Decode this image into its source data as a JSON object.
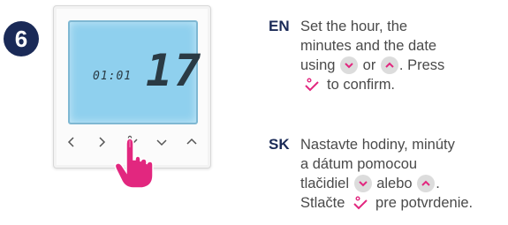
{
  "step": {
    "number": "6"
  },
  "device": {
    "time": "01:01",
    "day": "17",
    "buttons": [
      "left-arrow-icon",
      "right-arrow-icon",
      "confirm-icon",
      "down-arrow-icon",
      "up-arrow-icon"
    ]
  },
  "colors": {
    "badge": "#1a2a57",
    "screen": "#8fd0ee",
    "hand": "#e2277f",
    "accent_button": "#dcdcdc",
    "button_icon": "#e2277f"
  },
  "en": {
    "code": "EN",
    "line1": "Set the hour, the",
    "line2": "minutes and the date",
    "line3_a": "using",
    "line3_b": "or",
    "line3_c": ". Press",
    "line4": "to confirm."
  },
  "sk": {
    "code": "SK",
    "line1": "Nastavte hodiny, minúty",
    "line2": "a dátum pomocou",
    "line3_a": "tlačidiel",
    "line3_b": "alebo",
    "line3_c": ".",
    "line4_a": "Stlačte",
    "line4_b": "pre potvrdenie."
  }
}
